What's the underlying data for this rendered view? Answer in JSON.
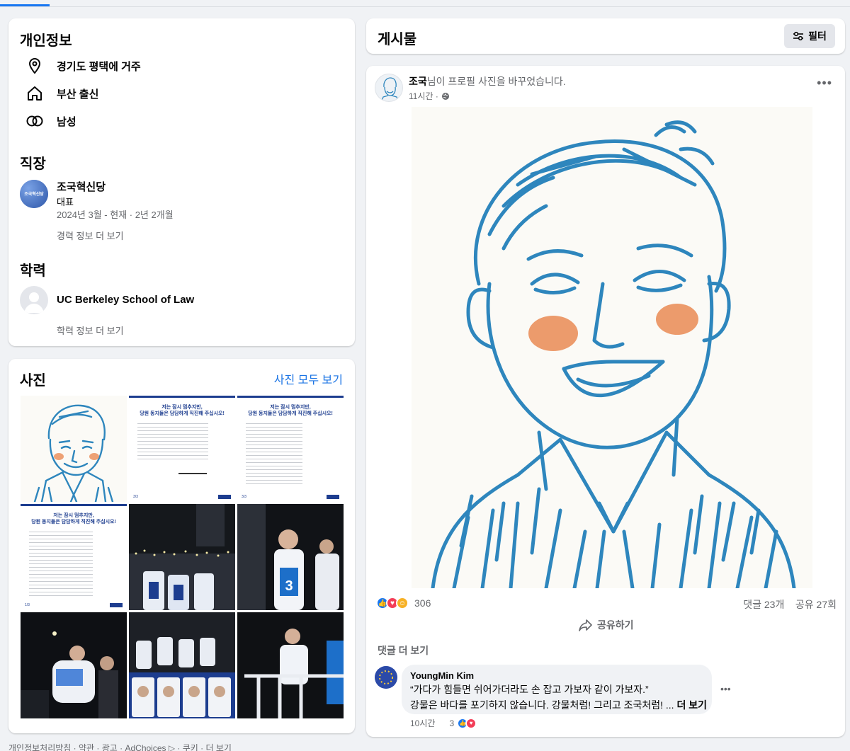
{
  "intro": {
    "title": "개인정보",
    "lives_in": "경기도 평택에 거주",
    "from": "부산 출신",
    "gender": "남성",
    "work_title": "직장",
    "work": {
      "org": "조국혁신당",
      "logo_text": "조국혁신당",
      "role": "대표",
      "period": "2024년 3월 - 현재 · 2년 2개월"
    },
    "work_more": "경력 정보 더 보기",
    "edu_title": "학력",
    "edu": {
      "school": "UC Berkeley School of Law"
    },
    "edu_more": "학력 정보 더 보기"
  },
  "photos": {
    "title": "사진",
    "see_all": "사진 모두 보기",
    "letter_heading": "저는 잠시 멈추지만,",
    "letter_heading2": "당원 동지들은 담담하게 직진해 주십시오!",
    "letter_page": "3/3",
    "letter_page2": "1/3"
  },
  "footer": "개인정보처리방침 · 약관 · 광고 · AdChoices ▷ · 쿠키 · 더 보기",
  "posts": {
    "title": "게시물",
    "filter_label": "필터",
    "post": {
      "author": "조국",
      "action": "님이 프로필 사진을 바꾸었습니다.",
      "time": "11시간 ·",
      "reaction_count": "306",
      "comments": "댓글 23개",
      "shares": "공유 27회",
      "share_label": "공유하기",
      "see_more_comments": "댓글 더 보기",
      "comment": {
        "name": "YoungMin Kim",
        "line1": "“가다가 힘들면 쉬어가더라도 손 잡고 가보자 같이 가보자.”",
        "line2": "강물은 바다를 포기하지 않습니다. 강물처럼! 그리고 조국처럼! ...",
        "more": "더 보기",
        "time": "10시간",
        "react_count": "3"
      }
    }
  },
  "colors": {
    "accent": "#1b74e4",
    "sketch_blue": "#2e86bd",
    "blush": "#e8834a"
  }
}
